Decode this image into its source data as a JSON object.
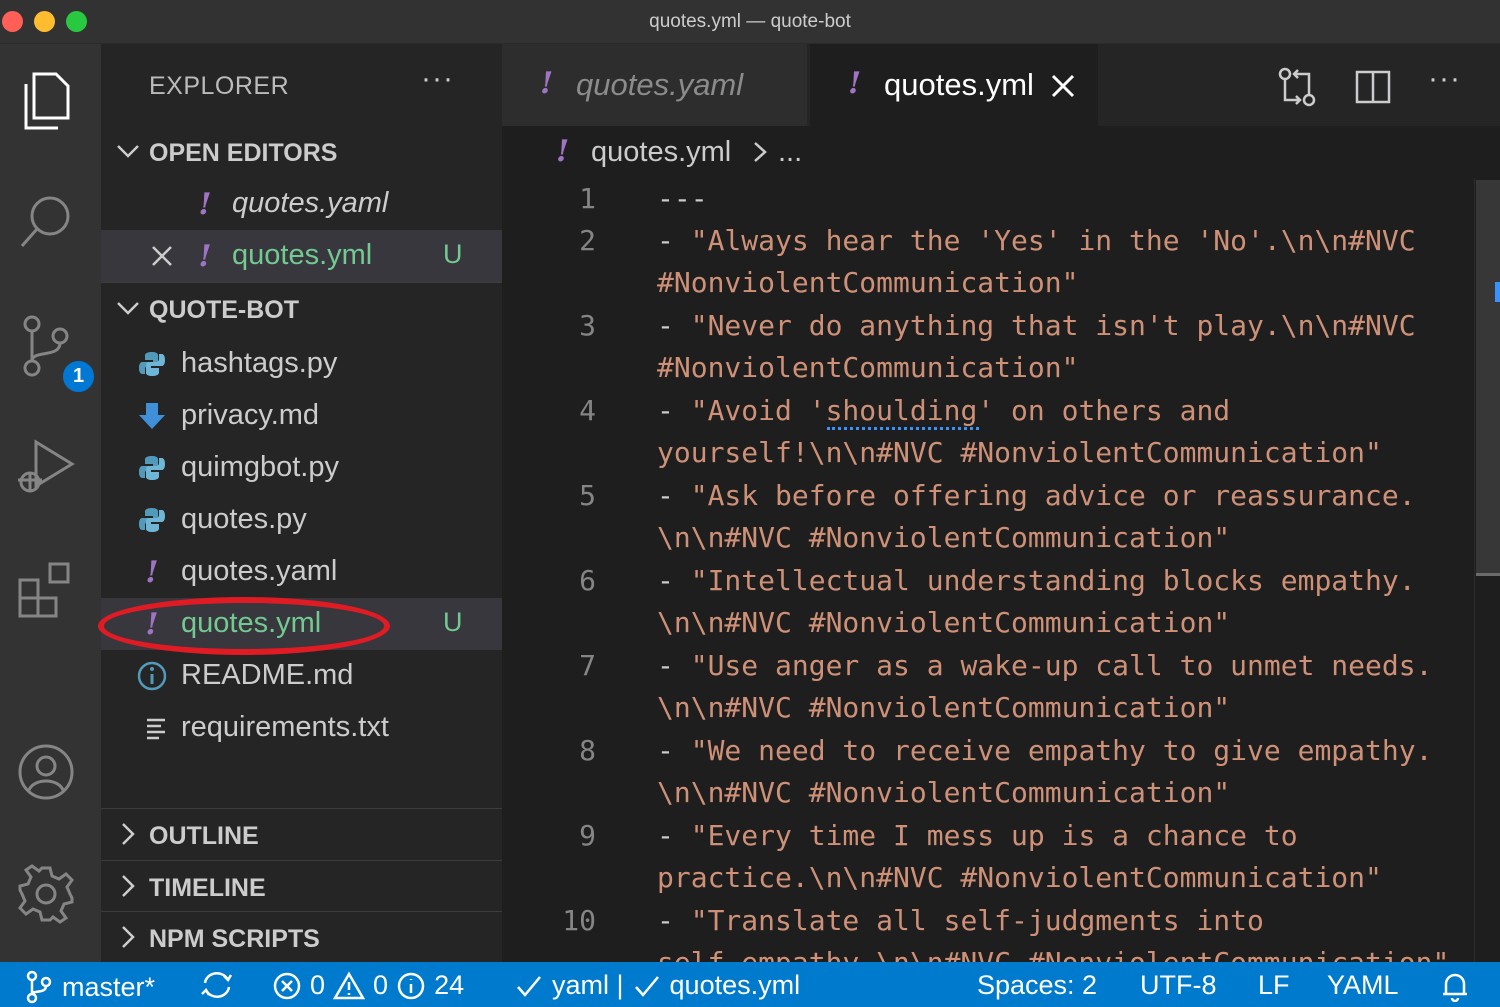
{
  "window": {
    "title": "quotes.yml — quote-bot"
  },
  "activity_bar": {
    "scm_badge": "1"
  },
  "sidebar": {
    "title": "EXPLORER",
    "more": "···",
    "open_editors": {
      "label": "OPEN EDITORS",
      "items": [
        {
          "name": "quotes.yaml",
          "status": ""
        },
        {
          "name": "quotes.yml",
          "status": "U"
        }
      ]
    },
    "project": {
      "label": "QUOTE-BOT",
      "files": [
        {
          "name": "hashtags.py",
          "icon": "python-icon",
          "status": ""
        },
        {
          "name": "privacy.md",
          "icon": "markdown-icon",
          "status": ""
        },
        {
          "name": "quimgbot.py",
          "icon": "python-icon",
          "status": ""
        },
        {
          "name": "quotes.py",
          "icon": "python-icon",
          "status": ""
        },
        {
          "name": "quotes.yaml",
          "icon": "yaml-icon",
          "status": ""
        },
        {
          "name": "quotes.yml",
          "icon": "yaml-icon",
          "status": "U"
        },
        {
          "name": "README.md",
          "icon": "info-icon",
          "status": ""
        },
        {
          "name": "requirements.txt",
          "icon": "text-file-icon",
          "status": ""
        }
      ]
    },
    "outline_label": "OUTLINE",
    "timeline_label": "TIMELINE",
    "npm_label": "NPM SCRIPTS"
  },
  "tabs": [
    {
      "label": "quotes.yaml",
      "active": false
    },
    {
      "label": "quotes.yml",
      "active": true
    }
  ],
  "breadcrumb": {
    "file": "quotes.yml",
    "more": "..."
  },
  "editor": {
    "line_numbers": [
      "1",
      "2",
      "3",
      "4",
      "5",
      "6",
      "7",
      "8",
      "9",
      "10"
    ],
    "lines": [
      {
        "dash": "---",
        "text": "",
        "cont": ""
      },
      {
        "dash": "- ",
        "text": "\"Always hear the 'Yes' in the 'No'.\\n\\n#NVC",
        "cont": "#NonviolentCommunication\""
      },
      {
        "dash": "- ",
        "text": "\"Never do anything that isn't play.\\n\\n#NVC",
        "cont": "#NonviolentCommunication\""
      },
      {
        "dash": "- ",
        "text": "\"Avoid 'shoulding' on others and",
        "cont": "yourself!\\n\\n#NVC #NonviolentCommunication\""
      },
      {
        "dash": "- ",
        "text": "\"Ask before offering advice or reassurance.",
        "cont": "\\n\\n#NVC #NonviolentCommunication\""
      },
      {
        "dash": "- ",
        "text": "\"Intellectual understanding blocks empathy.",
        "cont": "\\n\\n#NVC #NonviolentCommunication\""
      },
      {
        "dash": "- ",
        "text": "\"Use anger as a wake-up call to unmet needs.",
        "cont": "\\n\\n#NVC #NonviolentCommunication\""
      },
      {
        "dash": "- ",
        "text": "\"We need to receive empathy to give empathy.",
        "cont": "\\n\\n#NVC #NonviolentCommunication\""
      },
      {
        "dash": "- ",
        "text": "\"Every time I mess up is a chance to",
        "cont": "practice.\\n\\n#NVC #NonviolentCommunication\""
      },
      {
        "dash": "- ",
        "text": "\"Translate all self-judgments into",
        "cont": "self-empathy.\\n\\n#NVC #NonviolentCommunication\""
      }
    ]
  },
  "status_bar": {
    "branch": "master*",
    "errors": "0",
    "warnings": "0",
    "infos": "24",
    "yaml_check": "yaml |",
    "file_check": "quotes.yml",
    "spaces": "Spaces: 2",
    "encoding": "UTF-8",
    "eol": "LF",
    "language": "YAML"
  },
  "colors": {
    "accent": "#007acc",
    "untracked": "#73c991",
    "string": "#ce9178",
    "yaml_icon": "#a074c4",
    "highlight_oval": "#e01b24"
  }
}
